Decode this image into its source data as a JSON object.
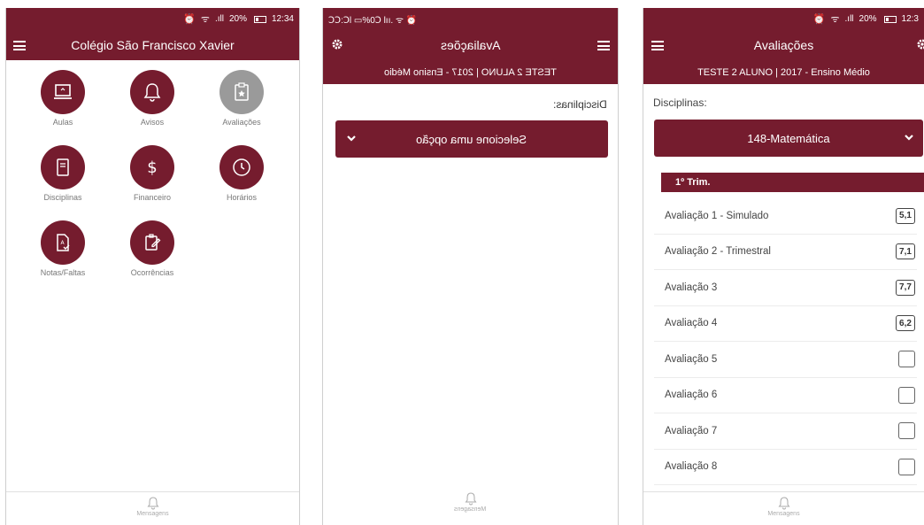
{
  "colors": {
    "primary": "#751c2e",
    "disabled_tile": "#9a9a9a"
  },
  "screen1": {
    "status": {
      "battery": "20%",
      "time": "12:34",
      "signal": ".ıll"
    },
    "title": "Colégio São Francisco Xavier",
    "tiles": [
      {
        "label": "Aulas",
        "icon": "laptop-icon",
        "color": "primary"
      },
      {
        "label": "Avisos",
        "icon": "bell-icon",
        "color": "primary"
      },
      {
        "label": "Avaliações",
        "icon": "clipboard-star-icon",
        "color": "grey"
      },
      {
        "label": "Disciplinas",
        "icon": "notebook-icon",
        "color": "primary"
      },
      {
        "label": "Financeiro",
        "icon": "dollar-icon",
        "color": "primary"
      },
      {
        "label": "Horários",
        "icon": "clock-icon",
        "color": "primary"
      },
      {
        "label": "Notas/Faltas",
        "icon": "grade-file-icon",
        "color": "primary"
      },
      {
        "label": "Ocorrências",
        "icon": "edit-note-icon",
        "color": "primary"
      }
    ],
    "bottom_nav": {
      "label": "Mensagens",
      "icon": "bell-icon"
    }
  },
  "screen2": {
    "status_text": "ꓛꓛ:ꓛl ▭%0ꓛ lıı. ᯤ ⏰",
    "title": "Avaliações",
    "subtitle": "TESTE 2 ALUNO | 2017 - Ensino Médio",
    "disciplinas_label": "Disciplinas:",
    "select_value": "Selecione uma opção",
    "bottom_nav": {
      "label": "Mensagens"
    }
  },
  "screen3": {
    "status": {
      "battery": "20%",
      "time": "12:3",
      "signal": ".ıll"
    },
    "title": "Avaliações",
    "subtitle": "TESTE 2 ALUNO | 2017 - Ensino Médio",
    "disciplinas_label": "Disciplinas:",
    "select_value": "148-Matemática",
    "trimester": "1º Trim.",
    "rows": [
      {
        "name": "Avaliação 1 - Simulado",
        "grade": "5,1"
      },
      {
        "name": "Avaliação 2 - Trimestral",
        "grade": "7,1"
      },
      {
        "name": "Avaliação 3",
        "grade": "7,7"
      },
      {
        "name": "Avaliação 4",
        "grade": "6,2"
      },
      {
        "name": "Avaliação 5",
        "grade": ""
      },
      {
        "name": "Avaliação 6",
        "grade": ""
      },
      {
        "name": "Avaliação 7",
        "grade": ""
      },
      {
        "name": "Avaliação 8",
        "grade": ""
      }
    ],
    "bottom_nav": {
      "label": "Mensagens"
    }
  }
}
